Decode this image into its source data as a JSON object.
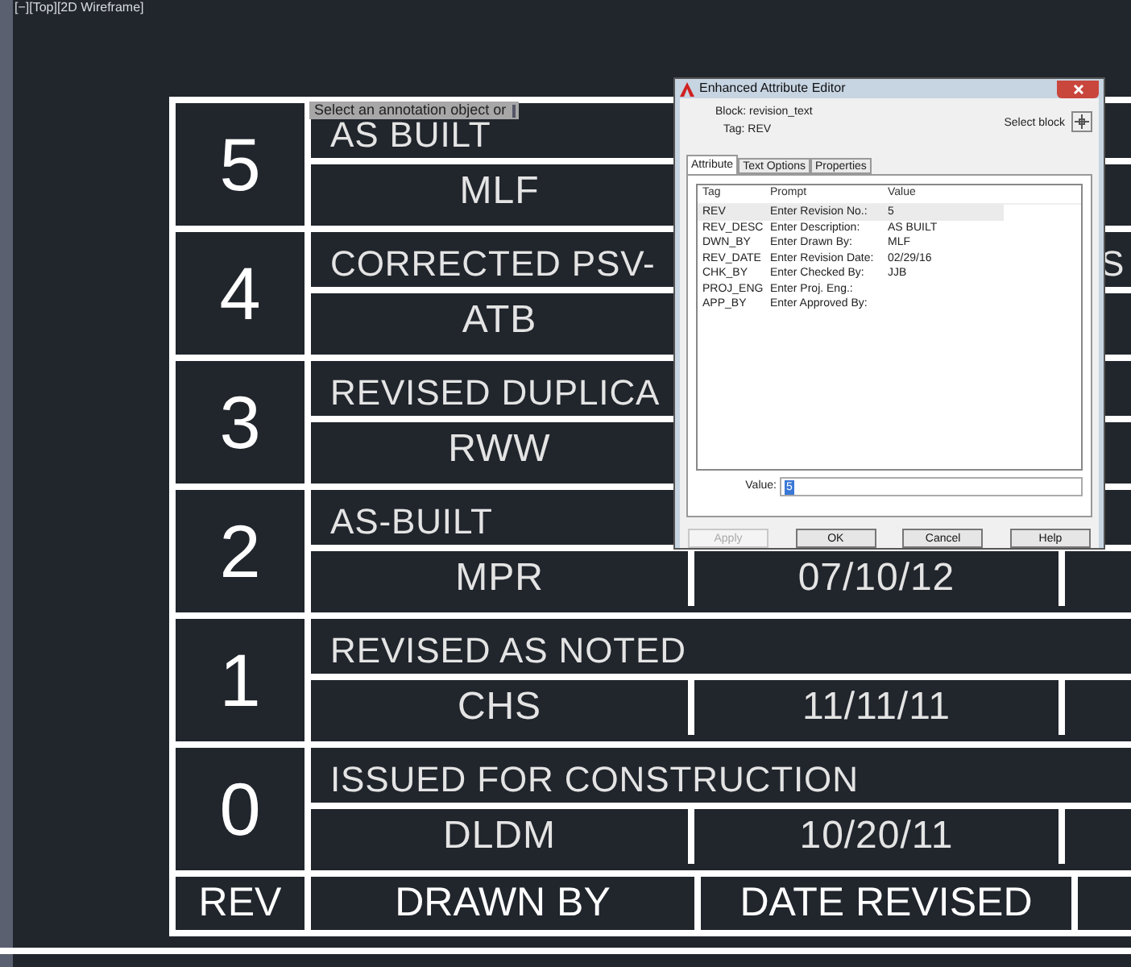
{
  "viewport_label": "[−][Top][2D Wireframe]",
  "table": {
    "revisions": [
      {
        "rev": "5",
        "description": "AS BUILT",
        "drawn_by": "MLF"
      },
      {
        "rev": "4",
        "description": "CORRECTED PSV-",
        "description_tail": "S",
        "drawn_by": "ATB"
      },
      {
        "rev": "3",
        "description": "REVISED DUPLICA",
        "drawn_by": "RWW"
      },
      {
        "rev": "2",
        "description": "AS-BUILT",
        "drawn_by": "MPR",
        "date": "07/10/12"
      },
      {
        "rev": "1",
        "description": "REVISED AS NOTED",
        "drawn_by": "CHS",
        "date": "11/11/11"
      },
      {
        "rev": "0",
        "description": "ISSUED FOR CONSTRUCTION",
        "drawn_by": "DLDM",
        "date": "10/20/11"
      }
    ],
    "header": [
      "REV",
      "DRAWN BY",
      "DATE REVISED"
    ]
  },
  "tooltip": {
    "text": "Select an annotation object or"
  },
  "dialog": {
    "title": "Enhanced Attribute Editor",
    "block": "Block: revision_text",
    "tag": "Tag: REV",
    "select_block": "Select block",
    "tabs": [
      {
        "label": "Attribute",
        "selected": true
      },
      {
        "label": "Text Options",
        "selected": false
      },
      {
        "label": "Properties",
        "selected": false
      }
    ],
    "columns": [
      "Tag",
      "Prompt",
      "Value"
    ],
    "rows": [
      {
        "tag": "REV",
        "prompt": "Enter Revision No.:",
        "value": "5",
        "selected": true
      },
      {
        "tag": "REV_DESC",
        "prompt": "Enter Description:",
        "value": "AS BUILT",
        "selected": false
      },
      {
        "tag": "DWN_BY",
        "prompt": "Enter Drawn By:",
        "value": "MLF",
        "selected": false
      },
      {
        "tag": "REV_DATE",
        "prompt": "Enter Revision Date:",
        "value": "02/29/16",
        "selected": false
      },
      {
        "tag": "CHK_BY",
        "prompt": "Enter Checked By:",
        "value": "JJB",
        "selected": false
      },
      {
        "tag": "PROJ_ENG",
        "prompt": "Enter Proj. Eng.:",
        "value": "",
        "selected": false
      },
      {
        "tag": "APP_BY",
        "prompt": "Enter Approved By:",
        "value": "",
        "selected": false
      }
    ],
    "value_label": "Value:",
    "value": "5",
    "buttons": [
      {
        "label": "Apply",
        "disabled": true
      },
      {
        "label": "OK",
        "disabled": false
      },
      {
        "label": "Cancel",
        "disabled": false
      },
      {
        "label": "Help",
        "disabled": false
      }
    ]
  }
}
